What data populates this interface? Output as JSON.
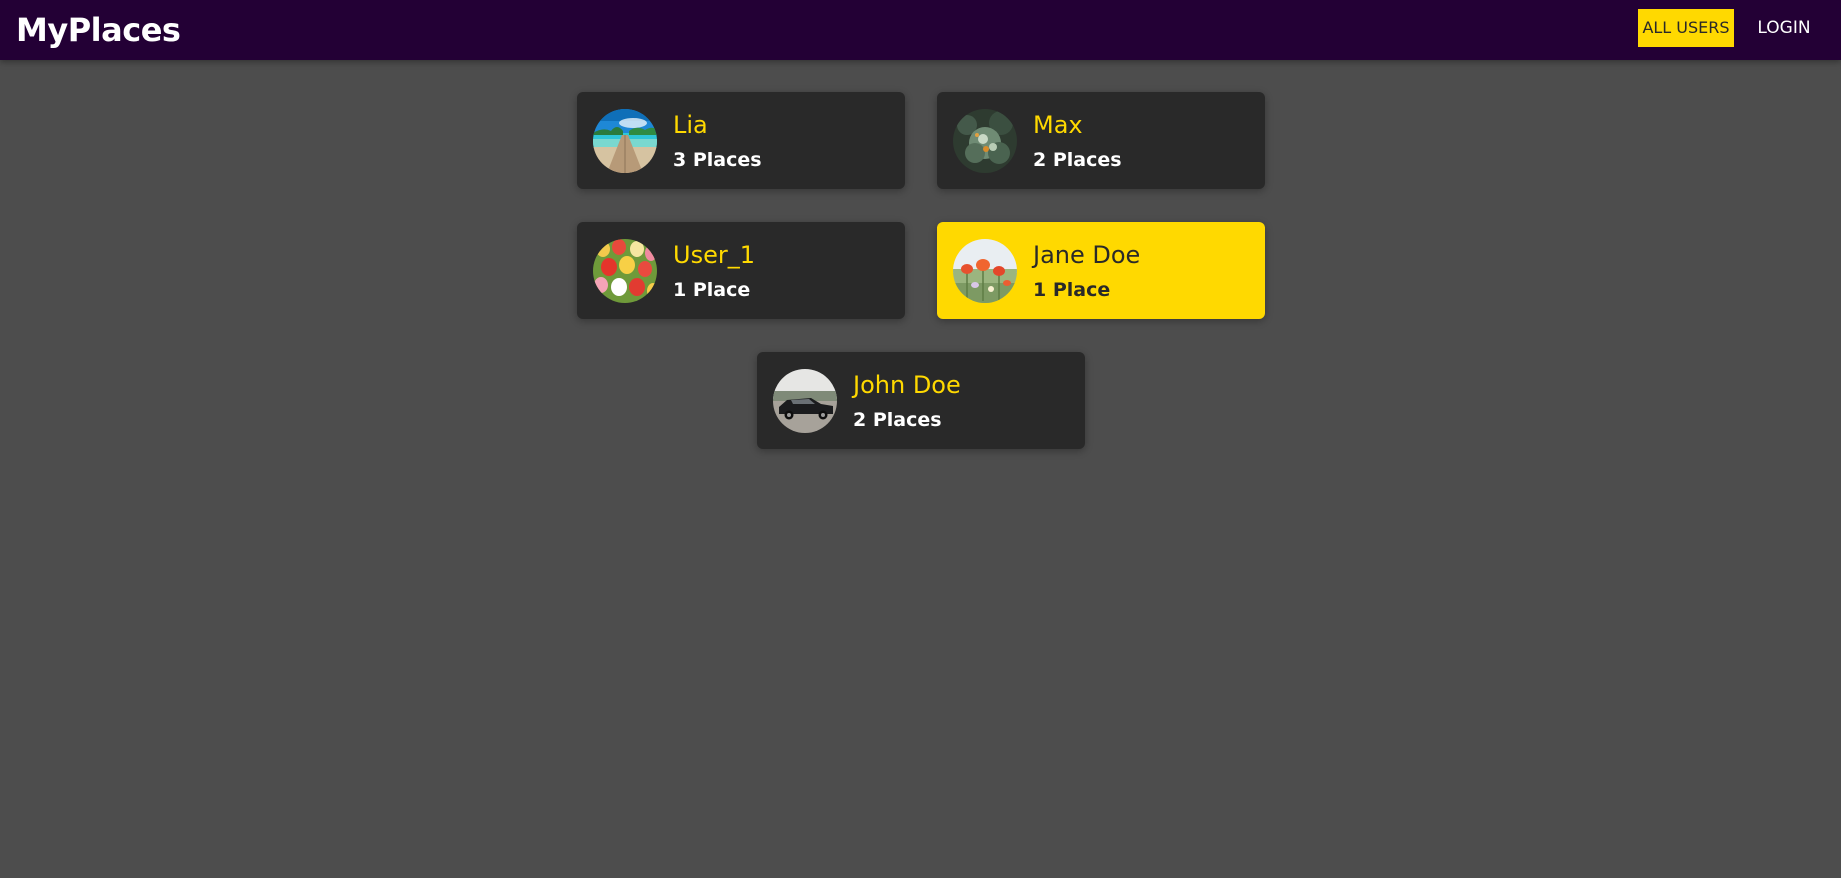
{
  "app": {
    "title": "MyPlaces"
  },
  "nav": {
    "all_users": "ALL USERS",
    "login": "LOGIN"
  },
  "users": [
    {
      "name": "Lia",
      "places": "3 Places",
      "active": false,
      "avatar": "beach-pier-photo"
    },
    {
      "name": "Max",
      "places": "2 Places",
      "active": false,
      "avatar": "forest-bush-photo"
    },
    {
      "name": "User_1",
      "places": "1 Place",
      "active": false,
      "avatar": "tulips-photo"
    },
    {
      "name": "Jane Doe",
      "places": "1 Place",
      "active": true,
      "avatar": "poppies-photo"
    },
    {
      "name": "John Doe",
      "places": "2 Places",
      "active": false,
      "avatar": "classic-car-photo"
    }
  ],
  "colors": {
    "header_bg": "#230035",
    "page_bg": "#4d4d4d",
    "card_bg": "#292929",
    "accent": "#ffd900",
    "text_light": "#ffffff",
    "text_dark": "#292929"
  }
}
